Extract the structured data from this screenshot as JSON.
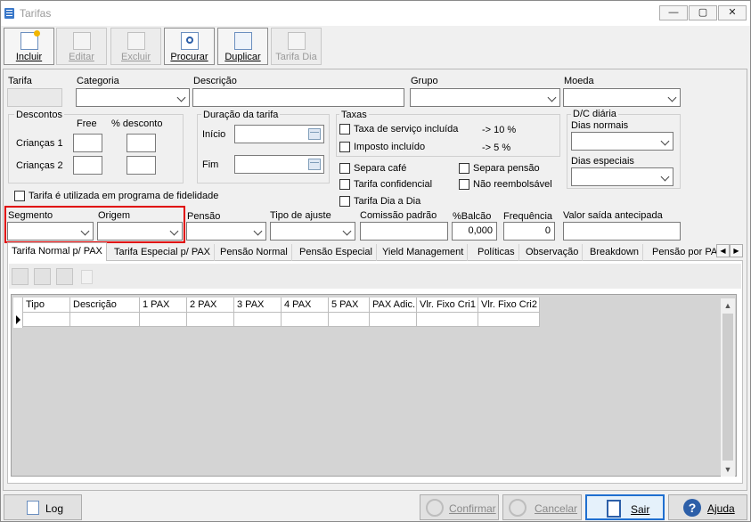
{
  "window": {
    "title": "Tarifas",
    "minimize": "—",
    "restore": "▢",
    "close": "✕"
  },
  "toolbar": {
    "incluir": "Incluir",
    "editar": "Editar",
    "excluir": "Excluir",
    "procurar": "Procurar",
    "duplicar": "Duplicar",
    "tarifa_dia": "Tarifa Dia"
  },
  "form": {
    "tarifa_label": "Tarifa",
    "categoria_label": "Categoria",
    "descricao_label": "Descrição",
    "grupo_label": "Grupo",
    "moeda_label": "Moeda",
    "descontos_label": "Descontos",
    "free_label": "Free",
    "pct_desconto_label": "% desconto",
    "criancas1_label": "Crianças 1",
    "criancas2_label": "Crianças 2",
    "duracao_label": "Duração da tarifa",
    "inicio_label": "Início",
    "fim_label": "Fim",
    "taxas_label": "Taxas",
    "taxa_servico_label": "Taxa de serviço incluída",
    "taxa_servico_value": "-> 10 %",
    "imposto_label": "Imposto incluído",
    "imposto_value": "-> 5  %",
    "dc_diaria_label": "D/C diária",
    "dias_normais_label": "Dias normais",
    "dias_especiais_label": "Dias especiais",
    "separa_cafe": "Separa café",
    "separa_pensao": "Separa pensão",
    "tarifa_confidencial": "Tarifa confidencial",
    "nao_reembolsavel": "Não reembolsável",
    "tarifa_dia_a_dia": "Tarifa Dia a Dia",
    "fidelidade": "Tarifa é utilizada em programa de fidelidade",
    "segmento_label": "Segmento",
    "origem_label": "Origem",
    "pensao_label": "Pensão",
    "tipo_ajuste_label": "Tipo de ajuste",
    "comissao_label": "Comissão padrão",
    "balcao_label": "%Balcão",
    "balcao_value": "0,000",
    "frequencia_label": "Frequência",
    "frequencia_value": "0",
    "valor_saida_label": "Valor saída antecipada"
  },
  "tabs": [
    "Tarifa Normal p/ PAX",
    "Tarifa Especial p/ PAX",
    "Pensão Normal",
    "Pensão Especial",
    "Yield Management",
    "Políticas",
    "Observação",
    "Breakdown",
    "Pensão por PA"
  ],
  "grid": {
    "columns": [
      "Tipo",
      "Descrição",
      "1 PAX",
      "2 PAX",
      "3 PAX",
      "4 PAX",
      "5 PAX",
      "PAX Adic.",
      "Vlr. Fixo Cri1",
      "Vlr. Fixo Cri2"
    ]
  },
  "footer": {
    "log": "Log",
    "confirmar": "Confirmar",
    "cancelar": "Cancelar",
    "sair": "Sair",
    "ajuda": "Ajuda"
  },
  "colors": {
    "highlight": "#e00000",
    "accent": "#3a78c9"
  }
}
